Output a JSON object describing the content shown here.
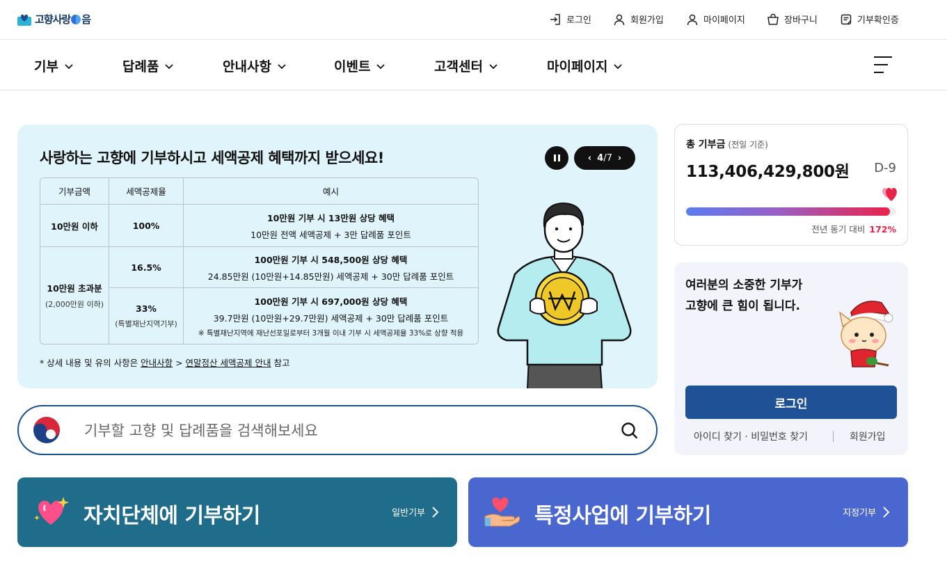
{
  "header": {
    "logo_text": "고향사랑",
    "logo_text_suffix": "음",
    "util_links": [
      {
        "label": "로그인",
        "icon": "login-icon"
      },
      {
        "label": "회원가입",
        "icon": "user-icon"
      },
      {
        "label": "마이페이지",
        "icon": "user-icon"
      },
      {
        "label": "장바구니",
        "icon": "cart-icon"
      },
      {
        "label": "기부확인증",
        "icon": "certificate-icon"
      }
    ]
  },
  "nav": {
    "items": [
      {
        "label": "기부"
      },
      {
        "label": "답례품"
      },
      {
        "label": "안내사항"
      },
      {
        "label": "이벤트"
      },
      {
        "label": "고객센터"
      },
      {
        "label": "마이페이지"
      }
    ],
    "menu_icon": "hamburger-icon"
  },
  "banner": {
    "title": "사랑하는 고향에 기부하시고 세액공제 혜택까지 받으세요!",
    "pager": {
      "current": "4",
      "total": "/7"
    },
    "table": {
      "headers": [
        "기부금액",
        "세액공제율",
        "예시"
      ],
      "rows": [
        {
          "amount": "10만원 이하",
          "rate": "100%",
          "ex1": "10만원 기부 시 13만원 상당 혜택",
          "ex2": "10만원 전액 세액공제 + 3만 답례품 포인트"
        },
        {
          "amount": "10만원 초과분",
          "amount_sub": "(2,000만원 이하)",
          "rate": "16.5%",
          "ex1": "100만원 기부 시 548,500원 상당 혜택",
          "ex2": "24.85만원 (10만원+14.85만원) 세액공제 + 30만 답례품 포인트"
        },
        {
          "rate": "33%",
          "rate_sub": "(특별재난지역기부)",
          "ex1": "100만원 기부 시 697,000원 상당 혜택",
          "ex2": "39.7만원 (10만원+29.7만원) 세액공제 + 30만 답례품 포인트",
          "note": "※ 특별재난지역에 재난선포일로부터 3개월 이내 기부 시 세액공제율 33%로 상향 적용"
        }
      ]
    },
    "foot_prefix": "* 상세 내용 및 유의 사항은 ",
    "foot_link1": "안내사항",
    "foot_mid": " > ",
    "foot_link2": "연말정산 세액공제 안내",
    "foot_suffix": " 참고"
  },
  "search": {
    "placeholder": "기부할 고향 및 답례품을 검색해보세요"
  },
  "total": {
    "label": "총 기부금",
    "basis": "(전일 기준)",
    "amount": "113,406,429,800원",
    "dday": "D-9",
    "progress": 0.97,
    "compare_label": "전년 동기 대비",
    "compare_value": "172%",
    "colors": {
      "accent": "#e8234a",
      "bar_start": "#5b7df0"
    }
  },
  "login": {
    "message_line1": "여러분의 소중한 기부가",
    "message_line2": "고향에 큰 힘이 됩니다.",
    "button": "로그인",
    "find": "아이디 찾기 · 비밀번호 찾기",
    "join": "회원가입"
  },
  "actions": [
    {
      "title": "자치단체에 기부하기",
      "sub": "일반기부",
      "color": "#1f6c8b",
      "icon": "sparkle-heart-icon"
    },
    {
      "title": "특정사업에 기부하기",
      "sub": "지정기부",
      "color": "#4a67d0",
      "icon": "hand-heart-icon"
    }
  ]
}
